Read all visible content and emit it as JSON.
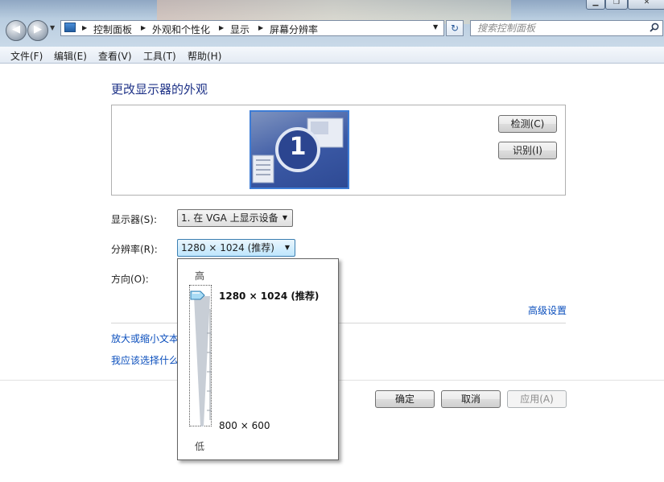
{
  "window": {
    "history_back_icon": "back-arrow-icon",
    "history_forward_icon": "forward-arrow-icon"
  },
  "address_bar": {
    "icon": "control-panel-icon",
    "breadcrumbs": [
      "控制面板",
      "外观和个性化",
      "显示",
      "屏幕分辨率"
    ]
  },
  "search": {
    "placeholder": "搜索控制面板",
    "icon": "search-icon"
  },
  "menubar": {
    "items": [
      "文件(F)",
      "编辑(E)",
      "查看(V)",
      "工具(T)",
      "帮助(H)"
    ]
  },
  "main": {
    "title": "更改显示器的外观",
    "monitor_number": "1",
    "detect_label": "检测(C)",
    "identify_label": "识别(I)",
    "display_label": "显示器(S):",
    "display_value": "1. 在 VGA 上显示设备",
    "resolution_label": "分辨率(R):",
    "resolution_value": "1280 × 1024 (推荐)",
    "orientation_label": "方向(O):",
    "advanced_link": "高级设置",
    "zoom_link": "放大或缩小文本",
    "howto_link": "我应该选择什么"
  },
  "footer": {
    "ok_label": "确定",
    "cancel_label": "取消",
    "apply_label": "应用(A)"
  },
  "resolution_popup": {
    "high_label": "高",
    "low_label": "低",
    "max_label": "1280 × 1024 (推荐)",
    "min_label": "800 × 600",
    "slider_position": 1.0
  },
  "colors": {
    "title_blue": "#1e3287",
    "link_blue": "#0b4fbd",
    "accent": "#3d7cd5"
  }
}
